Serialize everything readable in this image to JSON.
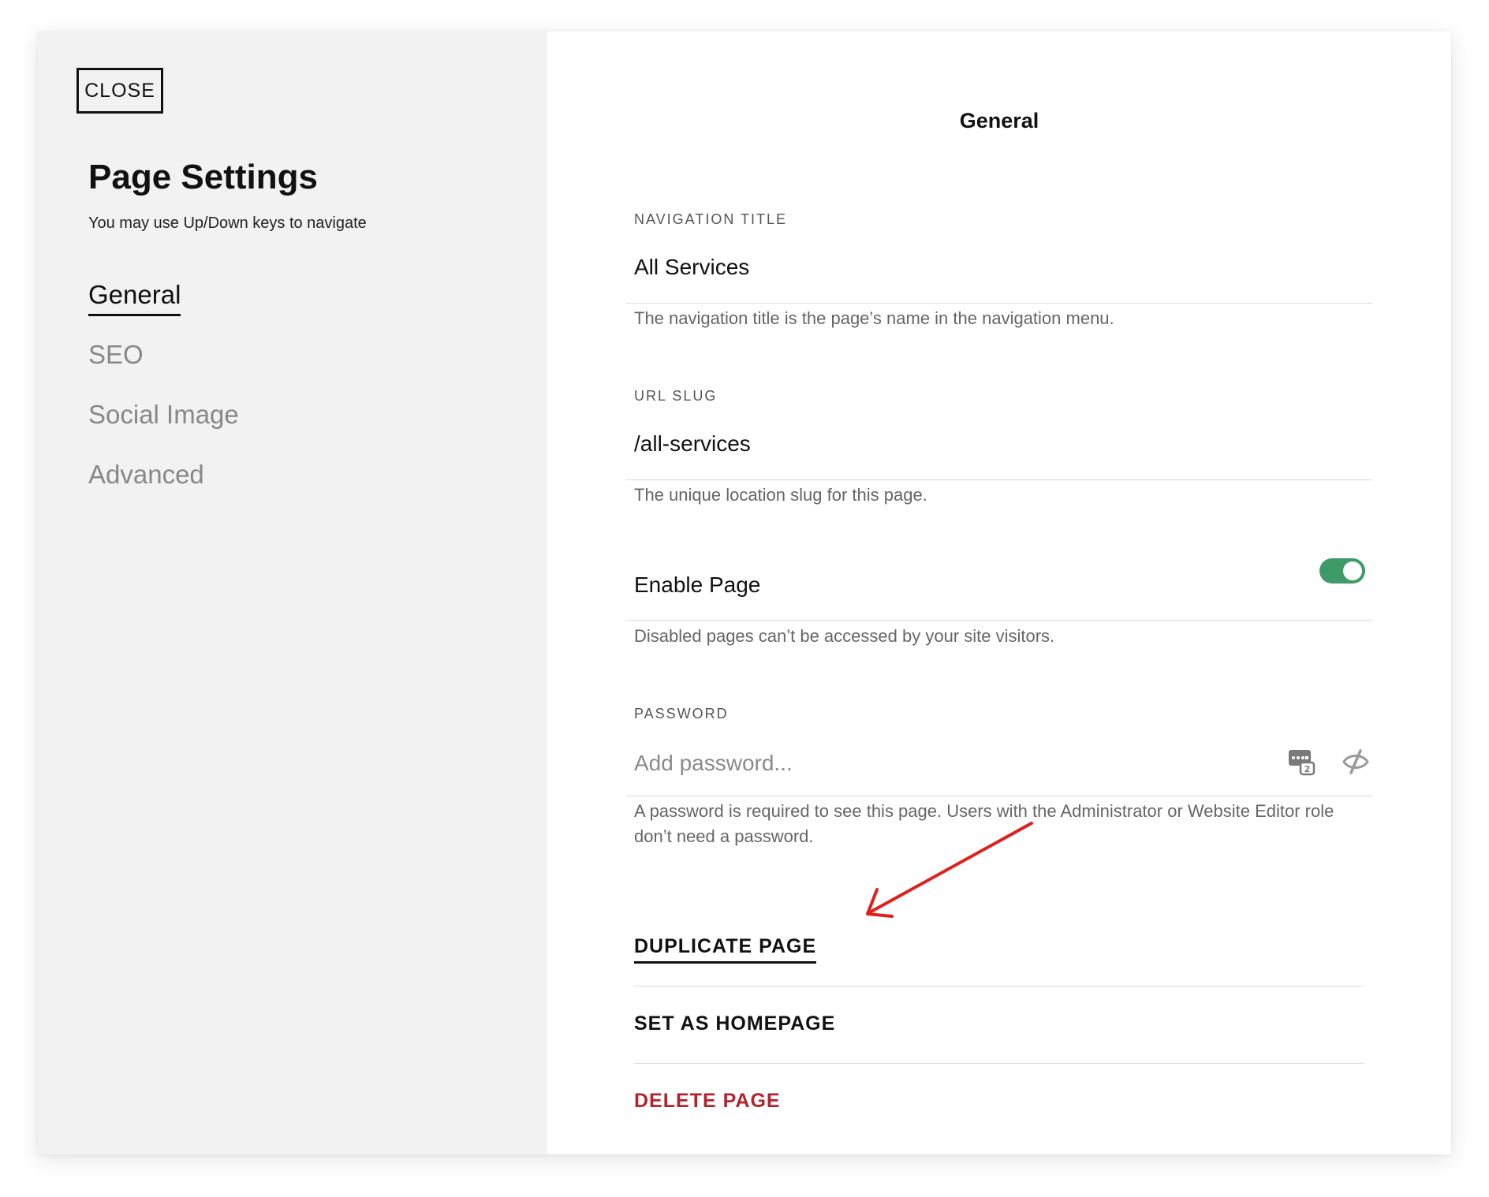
{
  "sidebar": {
    "close_label": "CLOSE",
    "title": "Page Settings",
    "hint": "You may use Up/Down keys to navigate",
    "nav": [
      {
        "label": "General",
        "active": true
      },
      {
        "label": "SEO",
        "active": false
      },
      {
        "label": "Social Image",
        "active": false
      },
      {
        "label": "Advanced",
        "active": false
      }
    ]
  },
  "panel": {
    "title": "General",
    "navigation_title": {
      "label": "NAVIGATION TITLE",
      "value": "All Services",
      "help": "The navigation title is the page’s name in the navigation menu."
    },
    "url_slug": {
      "label": "URL SLUG",
      "value": "/all-services",
      "help": "The unique location slug for this page."
    },
    "enable_page": {
      "label": "Enable Page",
      "enabled": true,
      "help": "Disabled pages can’t be accessed by your site visitors."
    },
    "password": {
      "label": "PASSWORD",
      "placeholder": "Add password...",
      "help": "A password is required to see this page. Users with the Administrator or Website Editor role don’t need a password."
    },
    "actions": {
      "duplicate": "DUPLICATE PAGE",
      "homepage": "SET AS HOMEPAGE",
      "delete": "DELETE PAGE"
    }
  },
  "colors": {
    "sidebar_bg": "#f2f2f2",
    "toggle_on": "#3f9a6a",
    "danger": "#b4232b",
    "annotation_arrow": "#e0201f"
  },
  "icons": {
    "password_manager": "password-generator-icon",
    "visibility": "eye-slash-icon"
  }
}
